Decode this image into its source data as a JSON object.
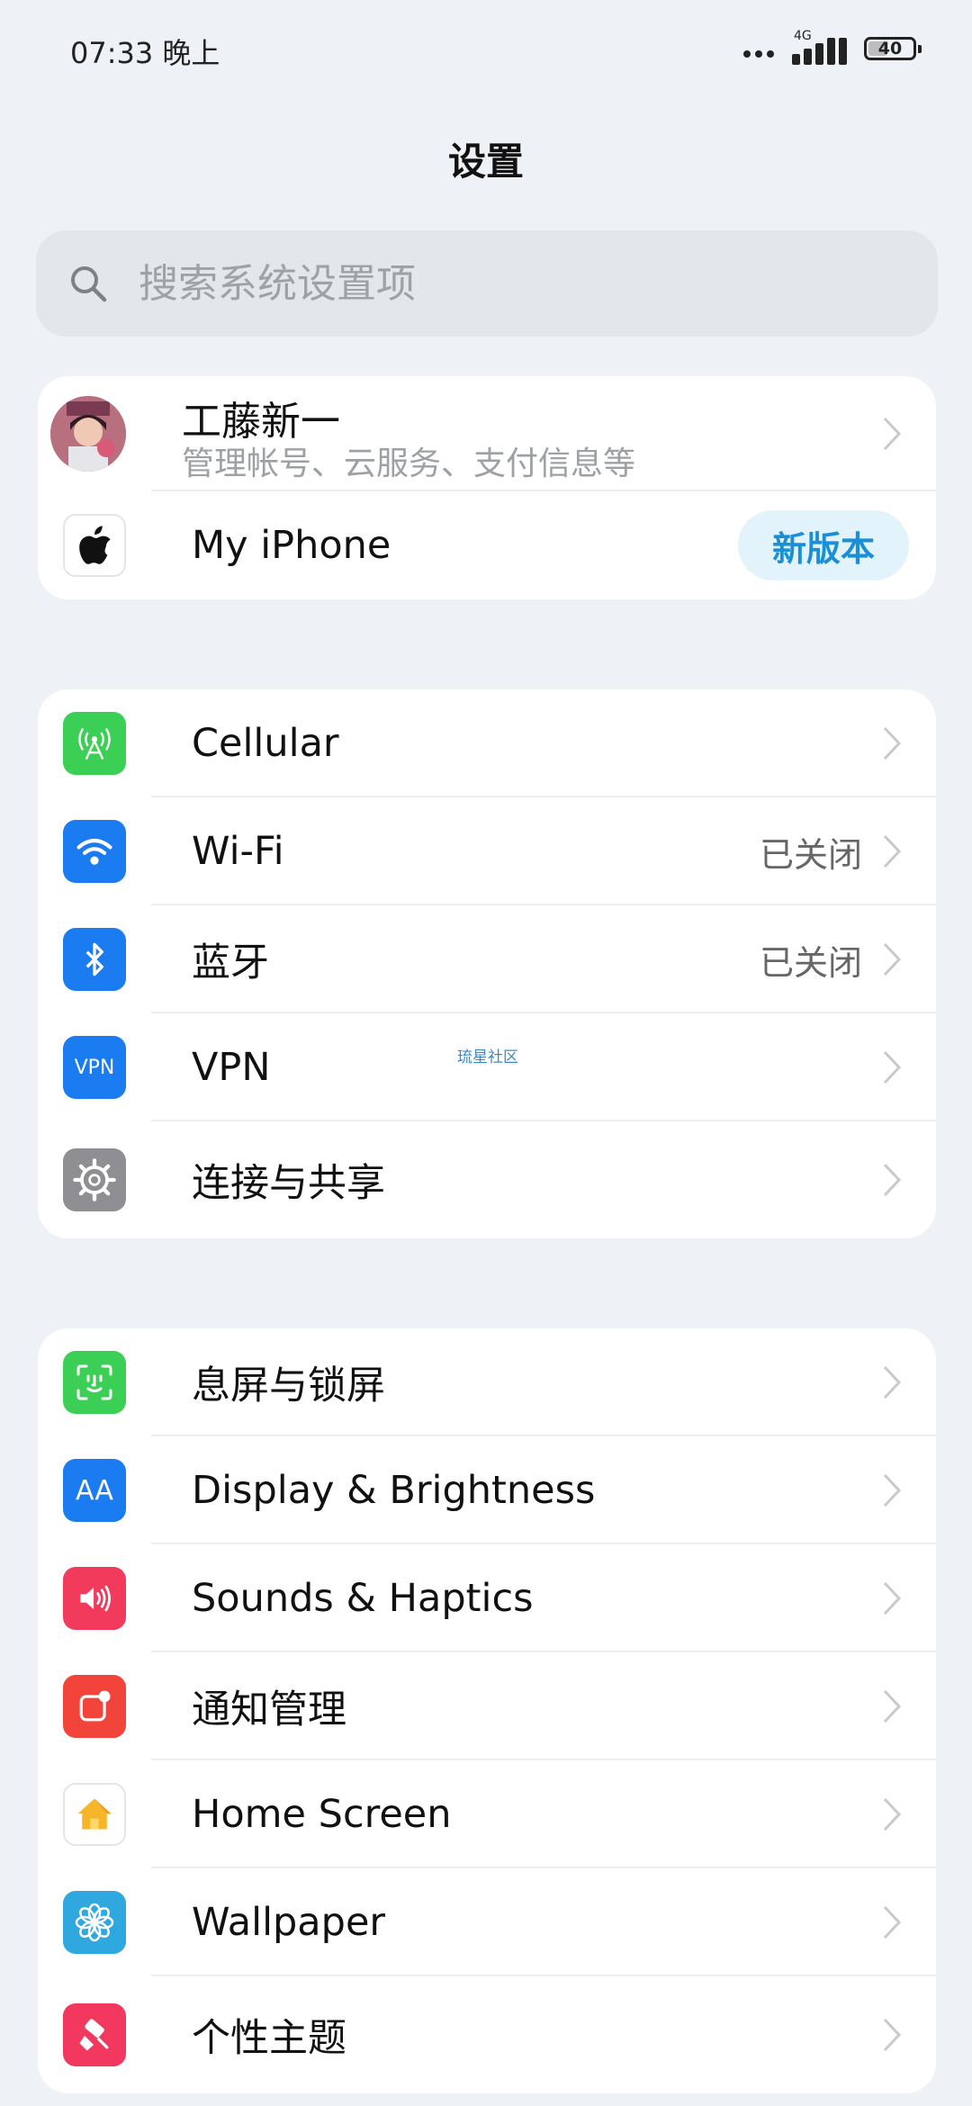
{
  "status_bar": {
    "time": "07:33 晚上",
    "network": "4G",
    "battery": "40"
  },
  "header": {
    "title": "设置"
  },
  "search": {
    "placeholder": "搜索系统设置项"
  },
  "account": {
    "name": "工藤新一",
    "subtitle": "管理帐号、云服务、支付信息等",
    "device_label": "My iPhone",
    "device_badge": "新版本"
  },
  "connectivity": [
    {
      "label": "Cellular",
      "icon": "cellular-icon",
      "color": "#3ccf55",
      "value": ""
    },
    {
      "label": "Wi-Fi",
      "icon": "wifi-icon",
      "color": "#1a7cf0",
      "value": "已关闭"
    },
    {
      "label": "蓝牙",
      "icon": "bluetooth-icon",
      "color": "#1a7cf0",
      "value": "已关闭"
    },
    {
      "label": "VPN",
      "icon": "vpn-icon",
      "icon_text": "VPN",
      "color": "#1a7cf0",
      "value": ""
    },
    {
      "label": "连接与共享",
      "icon": "gear-icon",
      "color": "#8e8e93",
      "value": ""
    }
  ],
  "watermark": "琉星社区",
  "general": [
    {
      "label": "息屏与锁屏",
      "icon": "face-id-icon",
      "color": "#3ccf55"
    },
    {
      "label": "Display & Brightness",
      "icon": "text-size-icon",
      "icon_text": "AA",
      "color": "#1a7cf0"
    },
    {
      "label": "Sounds & Haptics",
      "icon": "speaker-icon",
      "color": "#f23a5c"
    },
    {
      "label": "通知管理",
      "icon": "notification-icon",
      "color": "#f2443a"
    },
    {
      "label": "Home Screen",
      "icon": "home-icon",
      "color": "#ffffff"
    },
    {
      "label": "Wallpaper",
      "icon": "flower-icon",
      "color": "#2fa8e0"
    },
    {
      "label": "个性主题",
      "icon": "brush-icon",
      "color": "#f2385e"
    }
  ]
}
